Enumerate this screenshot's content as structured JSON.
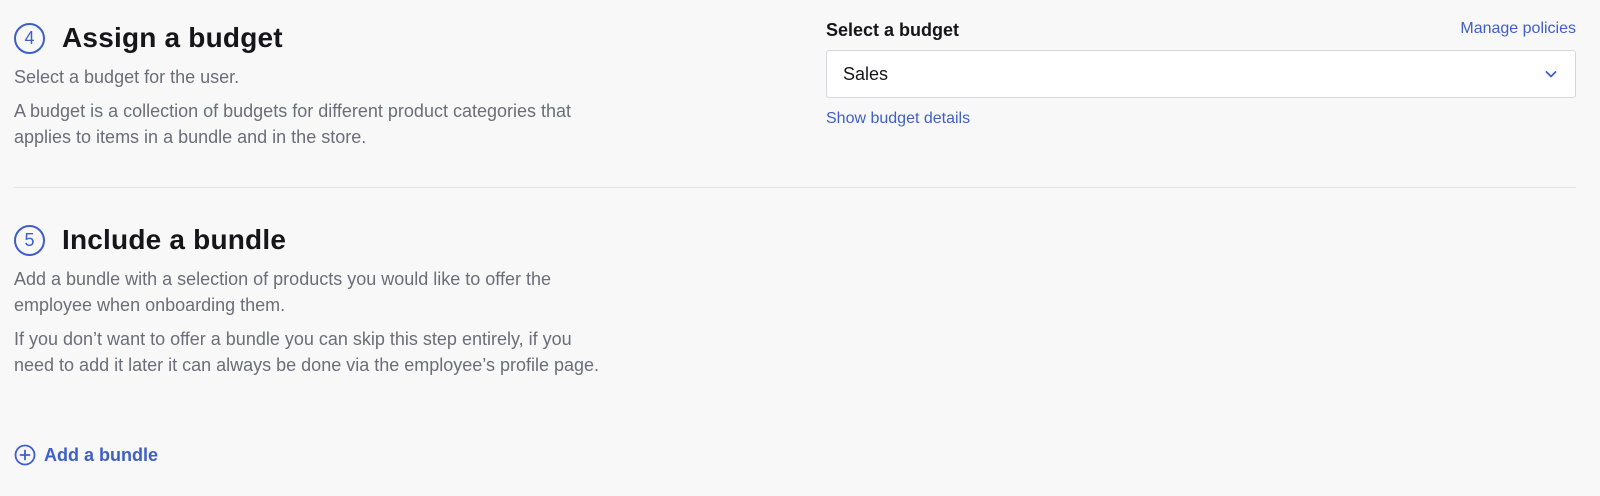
{
  "budget_step": {
    "number": "4",
    "title": "Assign a budget",
    "description": "Select a budget for the user.",
    "detail": "A budget is a collection of budgets for different product categories that applies to items in a bundle and in the store."
  },
  "budget_form": {
    "label": "Select a budget",
    "manage_link": "Manage policies",
    "selected_value": "Sales",
    "details_link": "Show budget details"
  },
  "bundle_step": {
    "number": "5",
    "title": "Include a bundle",
    "description": "Add a bundle with a selection of products you would like to offer the employee when onboarding them.",
    "detail": "If you don’t want to offer a bundle you can skip this step entirely, if you need to add it later it can always be done via the employee’s profile page.",
    "add_label": "Add a bundle"
  },
  "colors": {
    "accent": "#3f5fc8",
    "heading": "#15151a",
    "muted_text": "#6b6e78",
    "border": "#d7d8dd",
    "background": "#f8f8f9"
  },
  "icons": {
    "select_chevron": "chevron-down-icon",
    "add_bundle": "plus-circle-icon"
  }
}
